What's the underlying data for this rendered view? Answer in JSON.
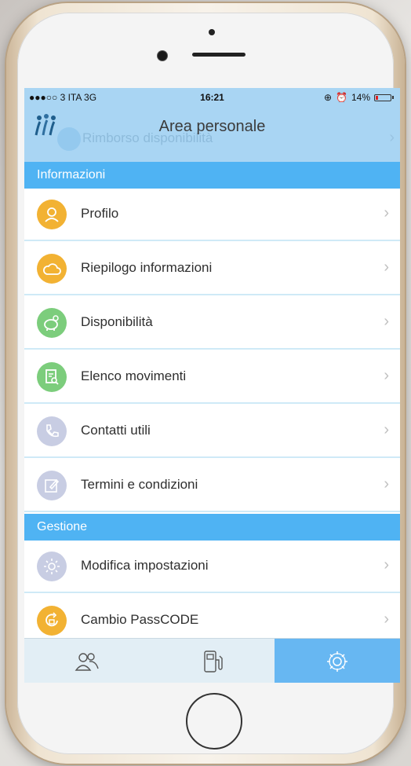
{
  "status_bar": {
    "carrier": "●●●○○ 3 ITA  3G",
    "time": "16:21",
    "battery": "14%",
    "battery_level": 0.14
  },
  "nav": {
    "title": "Area personale",
    "ghost_row_label": "Rimborso disponibilità"
  },
  "sections": [
    {
      "title": "Informazioni",
      "items": [
        {
          "label": "Profilo",
          "icon": "person-icon",
          "color": "#f2b233"
        },
        {
          "label": "Riepilogo informazioni",
          "icon": "cloud-icon",
          "color": "#f2b233"
        },
        {
          "label": "Disponibilità",
          "icon": "piggy-bank-icon",
          "color": "#7ccd7c"
        },
        {
          "label": "Elenco movimenti",
          "icon": "document-search-icon",
          "color": "#7ccd7c"
        },
        {
          "label": "Contatti utili",
          "icon": "phone-icon",
          "color": "#c8cde3"
        },
        {
          "label": "Termini e condizioni",
          "icon": "edit-icon",
          "color": "#c8cde3"
        }
      ]
    },
    {
      "title": "Gestione",
      "items": [
        {
          "label": "Modifica impostazioni",
          "icon": "gear-icon",
          "color": "#c8cde3"
        },
        {
          "label": "Cambio PassCODE",
          "icon": "lock-refresh-icon",
          "color": "#f2b233"
        }
      ]
    }
  ],
  "tabs": [
    {
      "icon": "users-icon",
      "active": false
    },
    {
      "icon": "fuel-pump-icon",
      "active": false
    },
    {
      "icon": "gear-icon",
      "active": true
    }
  ],
  "colors": {
    "nav_background": "#a9d5f3",
    "section_header": "#4fb3f3",
    "tab_active": "#67b7f2",
    "row_divider": "#cfeaf7"
  }
}
